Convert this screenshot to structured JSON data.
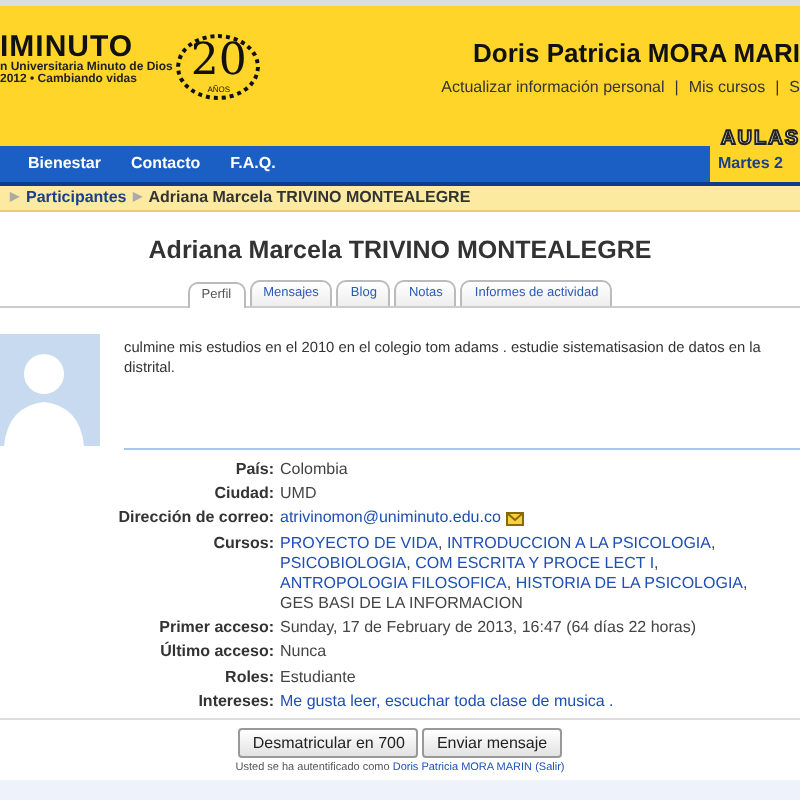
{
  "header": {
    "logo_word": "IMINUTO",
    "logo_line1": "n Universitaria Minuto de Dios",
    "logo_line2": "2012  •  Cambiando vidas",
    "anniversary": "20",
    "anniversary_small": "AÑOS",
    "user_name": "Doris Patricia MORA MARI",
    "user_links": [
      "Actualizar información personal",
      "Mis cursos",
      "S"
    ],
    "link_separator": "|",
    "aulas": "AULAS"
  },
  "nav": {
    "items": [
      "Bienestar",
      "Contacto",
      "F.A.Q."
    ],
    "date": "Martes 2"
  },
  "breadcrumb_separator": "▶",
  "breadcrumb": [
    "Participantes",
    "Adriana Marcela TRIVINO MONTEALEGRE"
  ],
  "title": "Adriana Marcela TRIVINO MONTEALEGRE",
  "tabs": [
    {
      "label": "Perfil",
      "selected": true
    },
    {
      "label": "Mensajes",
      "selected": false
    },
    {
      "label": "Blog",
      "selected": false
    },
    {
      "label": "Notas",
      "selected": false
    },
    {
      "label": "Informes de actividad",
      "selected": false
    }
  ],
  "description": [
    "culmine mis estudios en el 2010 en el colegio tom adams . estudie sistematisasion de datos en la",
    "distrital."
  ],
  "fields": [
    {
      "label": "País:",
      "kind": "text",
      "value": "Colombia"
    },
    {
      "label": "Ciudad:",
      "kind": "text",
      "value": "UMD"
    },
    {
      "label": "Dirección de correo:",
      "kind": "email",
      "value": "atrivinomon@uniminuto.edu.co"
    },
    {
      "label": "Cursos:",
      "kind": "courses",
      "separator": ",",
      "items": [
        {
          "text": "PROYECTO DE VIDA",
          "linked": true
        },
        {
          "text": "INTRODUCCION A LA PSICOLOGIA",
          "linked": true
        },
        {
          "text": "PSICOBIOLOGIA",
          "linked": true
        },
        {
          "text": "COM ESCRITA Y PROCE LECT I",
          "linked": true
        },
        {
          "text": "ANTROPOLOGIA FILOSOFICA",
          "linked": true
        },
        {
          "text": "HISTORIA DE LA PSICOLOGIA",
          "linked": true
        },
        {
          "text": "GES BASI DE LA INFORMACION",
          "linked": false
        }
      ]
    },
    {
      "label": "Primer acceso:",
      "kind": "text",
      "value": "Sunday, 17 de February de 2013, 16:47  (64 días 22 horas)"
    },
    {
      "label": "Último acceso:",
      "kind": "text",
      "value": "Nunca"
    },
    {
      "label": "Roles:",
      "kind": "text",
      "value": "Estudiante"
    },
    {
      "label": "Intereses:",
      "kind": "link",
      "value": "Me gusta leer, escuchar toda clase de musica ."
    }
  ],
  "buttons": [
    "Desmatricular en 700",
    "Enviar mensaje"
  ],
  "footer": {
    "prefix": "Usted se ha autentificado como",
    "user": "Doris Patricia MORA MARIN",
    "logout": "(Salir)"
  }
}
